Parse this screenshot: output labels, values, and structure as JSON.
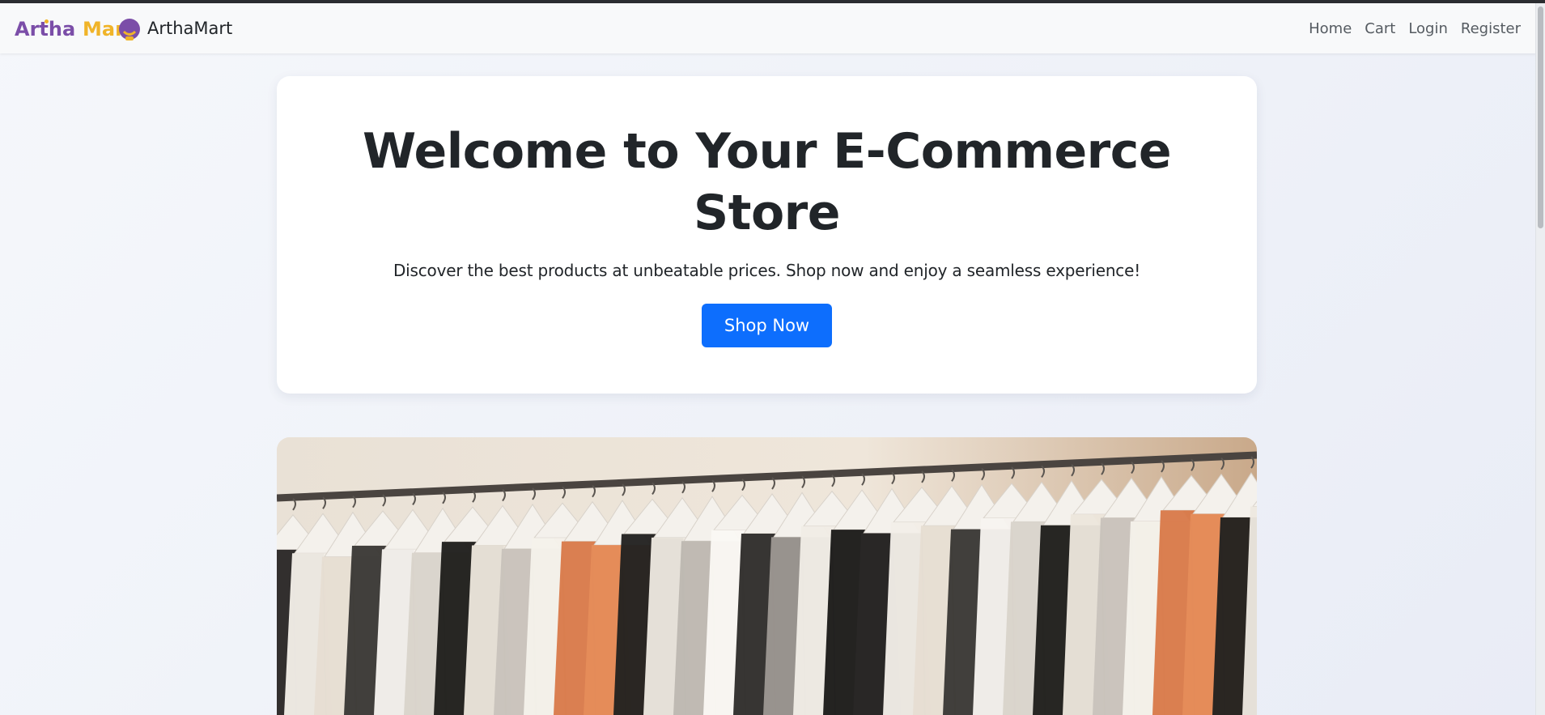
{
  "navbar": {
    "logo_part1": "Artha",
    "logo_part2": "Mart",
    "brand_name": "ArthaMart",
    "links": [
      "Home",
      "Cart",
      "Login",
      "Register"
    ]
  },
  "hero": {
    "title": "Welcome to Your E-Commerce Store",
    "subtitle": "Discover the best products at unbeatable prices. Shop now and enjoy a seamless experience!",
    "button_label": "Shop Now"
  },
  "colors": {
    "brand_purple": "#7b4ea8",
    "brand_gold": "#f0b429",
    "primary_button": "#0d6efd"
  },
  "icons": {
    "logo_mark": "shopping-bag-icon"
  }
}
